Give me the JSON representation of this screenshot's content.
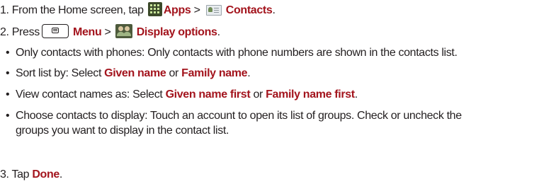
{
  "step1": {
    "prefix": "1. From the Home screen, tap",
    "apps_label": "Apps",
    "sep": ">",
    "contacts_label": "Contacts",
    "end": "."
  },
  "step2": {
    "prefix": "2. Press",
    "menu_label": "Menu",
    "sep": ">",
    "display_label": "Display options",
    "end": "."
  },
  "bullets": {
    "only_phones": "Only contacts with phones: Only contacts with phone numbers are shown in the contacts list.",
    "sort_prefix": "Sort list by: Select",
    "sort_opt1": "Given name",
    "sort_or": "or",
    "sort_opt2": "Family name",
    "sort_end": ".",
    "view_prefix": "View contact names as: Select",
    "view_opt1": "Given name first",
    "view_or": "or",
    "view_opt2": "Family name first",
    "view_end": ".",
    "choose_line1": "Choose contacts to display: Touch an account to open its list of groups. Check or uncheck the",
    "choose_line2": "groups you want to display in the contact list."
  },
  "step3": {
    "prefix": "3. Tap",
    "done_label": "Done",
    "end": "."
  },
  "icons": {
    "apps": "apps-grid-icon",
    "contacts": "contacts-icon",
    "menu": "menu-key-icon",
    "display": "people-icon"
  },
  "colors": {
    "text": "#231f20",
    "highlight": "#a3141d"
  }
}
